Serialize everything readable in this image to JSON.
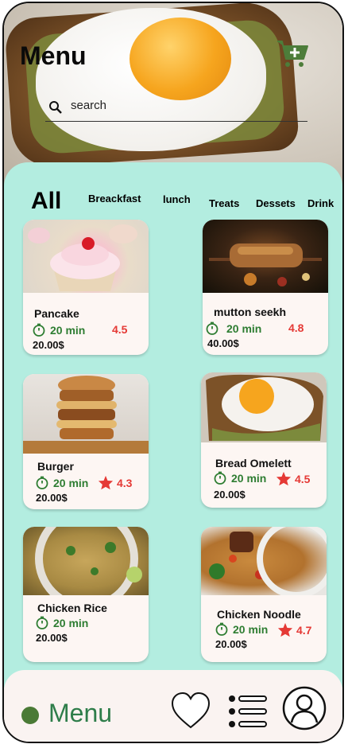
{
  "header": {
    "title": "Menu",
    "search_placeholder": "search",
    "cart_icon": "cart-add-icon"
  },
  "categories": {
    "active": "All",
    "items": [
      "Breackfast",
      "lunch",
      "Treats",
      "Dessets",
      "Drink"
    ]
  },
  "menu_items": [
    {
      "name": "Pancake",
      "time": "20 min",
      "rating": "4.5",
      "rating_star": false,
      "price": "20.00$"
    },
    {
      "name": "mutton seekh",
      "time": "20 min",
      "rating": "4.8",
      "rating_star": false,
      "price": "40.00$"
    },
    {
      "name": "Burger",
      "time": "20 min",
      "rating": "4.3",
      "rating_star": true,
      "price": "20.00$"
    },
    {
      "name": "Bread Omelett",
      "time": "20 min",
      "rating": "4.5",
      "rating_star": true,
      "price": "20.00$"
    },
    {
      "name": "Chicken Rice",
      "time": "20 min",
      "rating": "",
      "rating_star": false,
      "price": "20.00$"
    },
    {
      "name": "Chicken Noodle",
      "time": "20 min",
      "rating": "4.7",
      "rating_star": true,
      "price": "20.00$"
    }
  ],
  "bottom_nav": {
    "label": "Menu",
    "icons": [
      "heart-icon",
      "list-icon",
      "profile-icon"
    ]
  },
  "colors": {
    "panel": "#b3ede0",
    "accent_green": "#2e7d32",
    "rating_red": "#e53935"
  }
}
